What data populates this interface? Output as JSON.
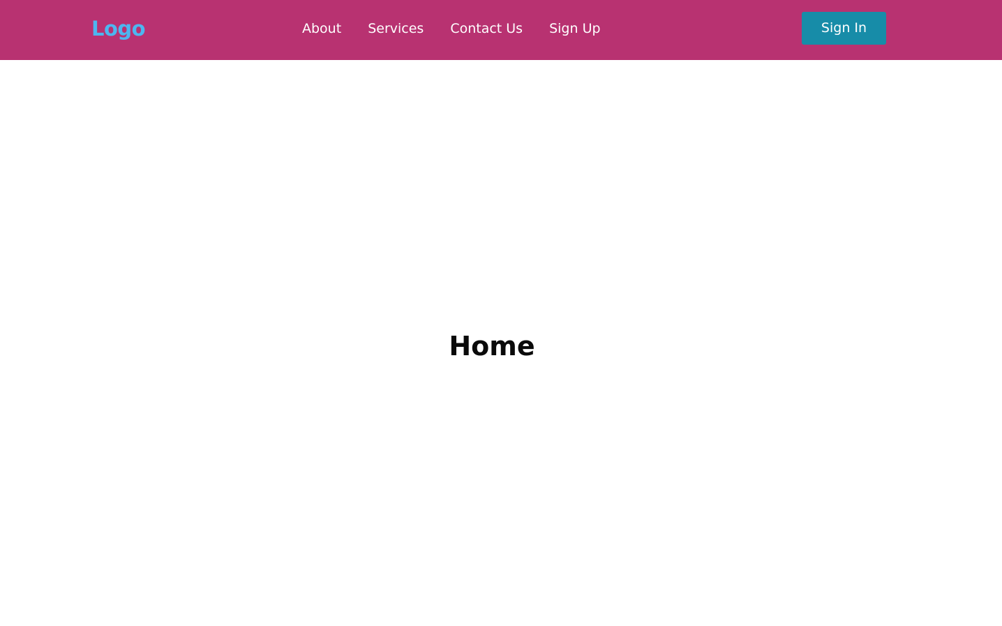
{
  "header": {
    "logo": "Logo",
    "nav": [
      {
        "label": "About"
      },
      {
        "label": "Services"
      },
      {
        "label": "Contact Us"
      },
      {
        "label": "Sign Up"
      }
    ],
    "signin_label": "Sign In"
  },
  "main": {
    "title": "Home"
  },
  "colors": {
    "header_bg": "#b83271",
    "logo": "#4db6f0",
    "button_bg": "#178ca8",
    "nav_text": "#ffffff",
    "title_text": "#0a0a0a"
  }
}
